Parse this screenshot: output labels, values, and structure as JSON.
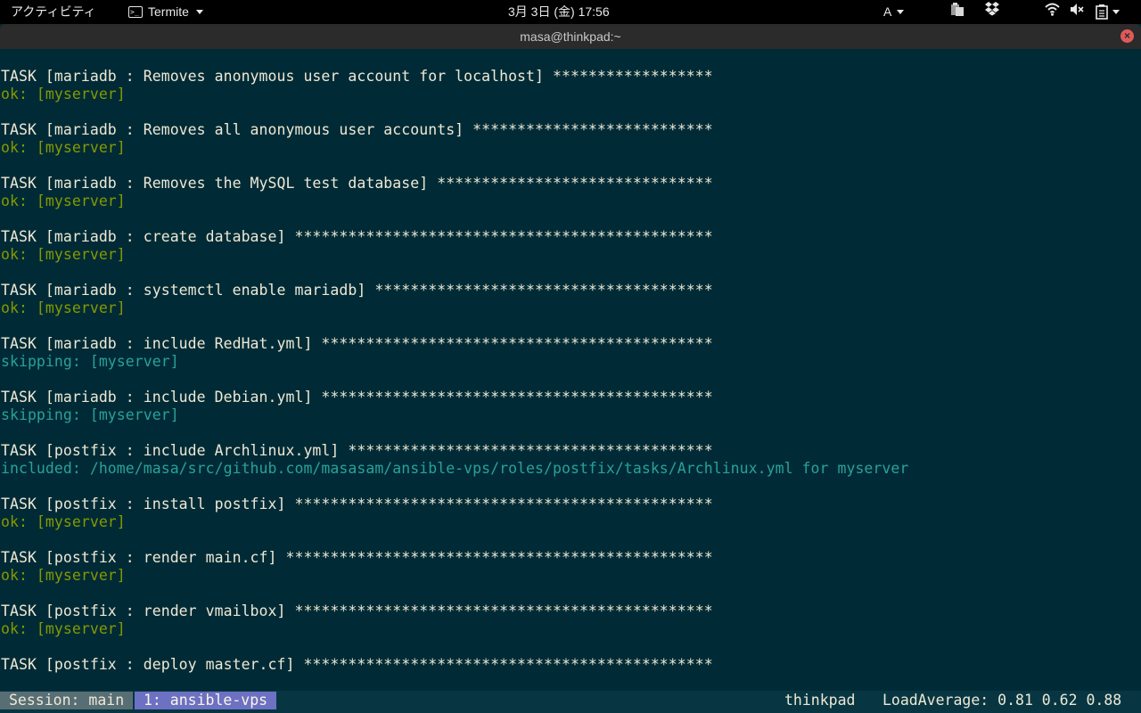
{
  "topbar": {
    "activities": "アクティビティ",
    "app_name": "Termite",
    "clock": "3月 3日 (金) 17:56",
    "input_method": "A"
  },
  "window": {
    "title": "masa@thinkpad:~"
  },
  "terminal": {
    "lines": [
      {
        "kind": "task",
        "text": "TASK [mariadb : Removes anonymous user account for localhost] ******************"
      },
      {
        "kind": "ok",
        "text": "ok: [myserver]"
      },
      {
        "kind": "blank",
        "text": ""
      },
      {
        "kind": "task",
        "text": "TASK [mariadb : Removes all anonymous user accounts] ***************************"
      },
      {
        "kind": "ok",
        "text": "ok: [myserver]"
      },
      {
        "kind": "blank",
        "text": ""
      },
      {
        "kind": "task",
        "text": "TASK [mariadb : Removes the MySQL test database] *******************************"
      },
      {
        "kind": "ok",
        "text": "ok: [myserver]"
      },
      {
        "kind": "blank",
        "text": ""
      },
      {
        "kind": "task",
        "text": "TASK [mariadb : create database] ***********************************************"
      },
      {
        "kind": "ok",
        "text": "ok: [myserver]"
      },
      {
        "kind": "blank",
        "text": ""
      },
      {
        "kind": "task",
        "text": "TASK [mariadb : systemctl enable mariadb] **************************************"
      },
      {
        "kind": "ok",
        "text": "ok: [myserver]"
      },
      {
        "kind": "blank",
        "text": ""
      },
      {
        "kind": "task",
        "text": "TASK [mariadb : include RedHat.yml] ********************************************"
      },
      {
        "kind": "skip",
        "text": "skipping: [myserver]"
      },
      {
        "kind": "blank",
        "text": ""
      },
      {
        "kind": "task",
        "text": "TASK [mariadb : include Debian.yml] ********************************************"
      },
      {
        "kind": "skip",
        "text": "skipping: [myserver]"
      },
      {
        "kind": "blank",
        "text": ""
      },
      {
        "kind": "task",
        "text": "TASK [postfix : include Archlinux.yml] *****************************************"
      },
      {
        "kind": "inc",
        "text": "included: /home/masa/src/github.com/masasam/ansible-vps/roles/postfix/tasks/Archlinux.yml for myserver"
      },
      {
        "kind": "blank",
        "text": ""
      },
      {
        "kind": "task",
        "text": "TASK [postfix : install postfix] ***********************************************"
      },
      {
        "kind": "ok",
        "text": "ok: [myserver]"
      },
      {
        "kind": "blank",
        "text": ""
      },
      {
        "kind": "task",
        "text": "TASK [postfix : render main.cf] ************************************************"
      },
      {
        "kind": "ok",
        "text": "ok: [myserver]"
      },
      {
        "kind": "blank",
        "text": ""
      },
      {
        "kind": "task",
        "text": "TASK [postfix : render vmailbox] ***********************************************"
      },
      {
        "kind": "ok",
        "text": "ok: [myserver]"
      },
      {
        "kind": "blank",
        "text": ""
      },
      {
        "kind": "task",
        "text": "TASK [postfix : deploy master.cf] **********************************************"
      }
    ]
  },
  "statusbar": {
    "session": "Session: main",
    "window_tab": "1: ansible-vps",
    "host": "thinkpad",
    "load": "LoadAverage: 0.81 0.62 0.88"
  },
  "colors": {
    "terminal_bg": "#002b36",
    "task_text": "#eee8d5",
    "ok_text": "#859900",
    "skip_text": "#2aa198",
    "status_tab": "#6c71c4"
  },
  "icons": {
    "app_menu": "terminal-icon",
    "tray_1": "clipboard-icon",
    "tray_2": "dropbox-icon",
    "network": "wifi-icon",
    "sound": "volume-muted-icon",
    "power": "battery-icon"
  }
}
